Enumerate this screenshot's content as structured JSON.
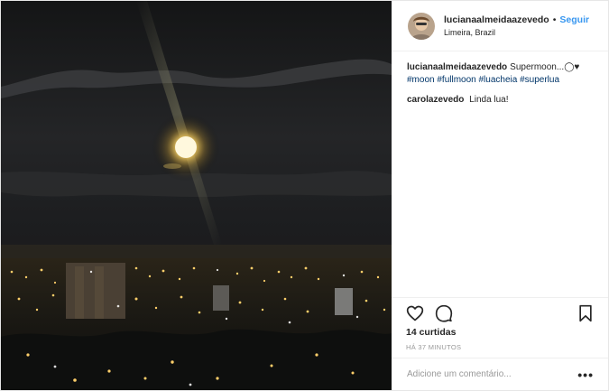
{
  "header": {
    "username": "lucianaalmeidaazevedo",
    "separator": "•",
    "follow_label": "Seguir",
    "location": "Limeira, Brazil"
  },
  "caption": {
    "username": "lucianaalmeidaazevedo",
    "text": "Supermoon...◯♥",
    "hashtags": [
      "#moon",
      "#fullmoon",
      "#luacheia",
      "#superlua"
    ]
  },
  "comments": [
    {
      "username": "carolazevedo",
      "text": "Linda lua!"
    }
  ],
  "actions": {
    "likes": "14 curtidas",
    "timestamp": "HÁ 37 MINUTOS"
  },
  "add_comment": {
    "placeholder": "Adicione um comentário...",
    "more_label": "•••"
  },
  "icons": {
    "like": "heart-icon",
    "comment": "comment-icon",
    "save": "bookmark-icon",
    "more": "more-options-icon"
  },
  "colors": {
    "link": "#3897f0",
    "hashtag": "#003569",
    "meta": "#999999"
  }
}
